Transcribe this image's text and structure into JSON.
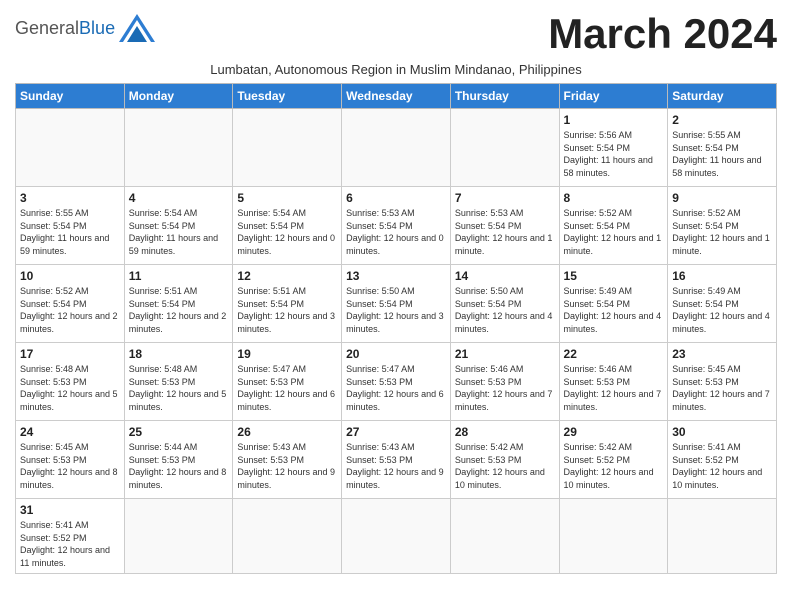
{
  "header": {
    "logo_general": "General",
    "logo_blue": "Blue",
    "month_title": "March 2024",
    "subtitle": "Lumbatan, Autonomous Region in Muslim Mindanao, Philippines"
  },
  "days_of_week": [
    "Sunday",
    "Monday",
    "Tuesday",
    "Wednesday",
    "Thursday",
    "Friday",
    "Saturday"
  ],
  "weeks": [
    [
      {
        "day": "",
        "info": ""
      },
      {
        "day": "",
        "info": ""
      },
      {
        "day": "",
        "info": ""
      },
      {
        "day": "",
        "info": ""
      },
      {
        "day": "",
        "info": ""
      },
      {
        "day": "1",
        "info": "Sunrise: 5:56 AM\nSunset: 5:54 PM\nDaylight: 11 hours and 58 minutes."
      },
      {
        "day": "2",
        "info": "Sunrise: 5:55 AM\nSunset: 5:54 PM\nDaylight: 11 hours and 58 minutes."
      }
    ],
    [
      {
        "day": "3",
        "info": "Sunrise: 5:55 AM\nSunset: 5:54 PM\nDaylight: 11 hours and 59 minutes."
      },
      {
        "day": "4",
        "info": "Sunrise: 5:54 AM\nSunset: 5:54 PM\nDaylight: 11 hours and 59 minutes."
      },
      {
        "day": "5",
        "info": "Sunrise: 5:54 AM\nSunset: 5:54 PM\nDaylight: 12 hours and 0 minutes."
      },
      {
        "day": "6",
        "info": "Sunrise: 5:53 AM\nSunset: 5:54 PM\nDaylight: 12 hours and 0 minutes."
      },
      {
        "day": "7",
        "info": "Sunrise: 5:53 AM\nSunset: 5:54 PM\nDaylight: 12 hours and 1 minute."
      },
      {
        "day": "8",
        "info": "Sunrise: 5:52 AM\nSunset: 5:54 PM\nDaylight: 12 hours and 1 minute."
      },
      {
        "day": "9",
        "info": "Sunrise: 5:52 AM\nSunset: 5:54 PM\nDaylight: 12 hours and 1 minute."
      }
    ],
    [
      {
        "day": "10",
        "info": "Sunrise: 5:52 AM\nSunset: 5:54 PM\nDaylight: 12 hours and 2 minutes."
      },
      {
        "day": "11",
        "info": "Sunrise: 5:51 AM\nSunset: 5:54 PM\nDaylight: 12 hours and 2 minutes."
      },
      {
        "day": "12",
        "info": "Sunrise: 5:51 AM\nSunset: 5:54 PM\nDaylight: 12 hours and 3 minutes."
      },
      {
        "day": "13",
        "info": "Sunrise: 5:50 AM\nSunset: 5:54 PM\nDaylight: 12 hours and 3 minutes."
      },
      {
        "day": "14",
        "info": "Sunrise: 5:50 AM\nSunset: 5:54 PM\nDaylight: 12 hours and 4 minutes."
      },
      {
        "day": "15",
        "info": "Sunrise: 5:49 AM\nSunset: 5:54 PM\nDaylight: 12 hours and 4 minutes."
      },
      {
        "day": "16",
        "info": "Sunrise: 5:49 AM\nSunset: 5:54 PM\nDaylight: 12 hours and 4 minutes."
      }
    ],
    [
      {
        "day": "17",
        "info": "Sunrise: 5:48 AM\nSunset: 5:53 PM\nDaylight: 12 hours and 5 minutes."
      },
      {
        "day": "18",
        "info": "Sunrise: 5:48 AM\nSunset: 5:53 PM\nDaylight: 12 hours and 5 minutes."
      },
      {
        "day": "19",
        "info": "Sunrise: 5:47 AM\nSunset: 5:53 PM\nDaylight: 12 hours and 6 minutes."
      },
      {
        "day": "20",
        "info": "Sunrise: 5:47 AM\nSunset: 5:53 PM\nDaylight: 12 hours and 6 minutes."
      },
      {
        "day": "21",
        "info": "Sunrise: 5:46 AM\nSunset: 5:53 PM\nDaylight: 12 hours and 7 minutes."
      },
      {
        "day": "22",
        "info": "Sunrise: 5:46 AM\nSunset: 5:53 PM\nDaylight: 12 hours and 7 minutes."
      },
      {
        "day": "23",
        "info": "Sunrise: 5:45 AM\nSunset: 5:53 PM\nDaylight: 12 hours and 7 minutes."
      }
    ],
    [
      {
        "day": "24",
        "info": "Sunrise: 5:45 AM\nSunset: 5:53 PM\nDaylight: 12 hours and 8 minutes."
      },
      {
        "day": "25",
        "info": "Sunrise: 5:44 AM\nSunset: 5:53 PM\nDaylight: 12 hours and 8 minutes."
      },
      {
        "day": "26",
        "info": "Sunrise: 5:43 AM\nSunset: 5:53 PM\nDaylight: 12 hours and 9 minutes."
      },
      {
        "day": "27",
        "info": "Sunrise: 5:43 AM\nSunset: 5:53 PM\nDaylight: 12 hours and 9 minutes."
      },
      {
        "day": "28",
        "info": "Sunrise: 5:42 AM\nSunset: 5:53 PM\nDaylight: 12 hours and 10 minutes."
      },
      {
        "day": "29",
        "info": "Sunrise: 5:42 AM\nSunset: 5:52 PM\nDaylight: 12 hours and 10 minutes."
      },
      {
        "day": "30",
        "info": "Sunrise: 5:41 AM\nSunset: 5:52 PM\nDaylight: 12 hours and 10 minutes."
      }
    ],
    [
      {
        "day": "31",
        "info": "Sunrise: 5:41 AM\nSunset: 5:52 PM\nDaylight: 12 hours and 11 minutes."
      },
      {
        "day": "",
        "info": ""
      },
      {
        "day": "",
        "info": ""
      },
      {
        "day": "",
        "info": ""
      },
      {
        "day": "",
        "info": ""
      },
      {
        "day": "",
        "info": ""
      },
      {
        "day": "",
        "info": ""
      }
    ]
  ]
}
